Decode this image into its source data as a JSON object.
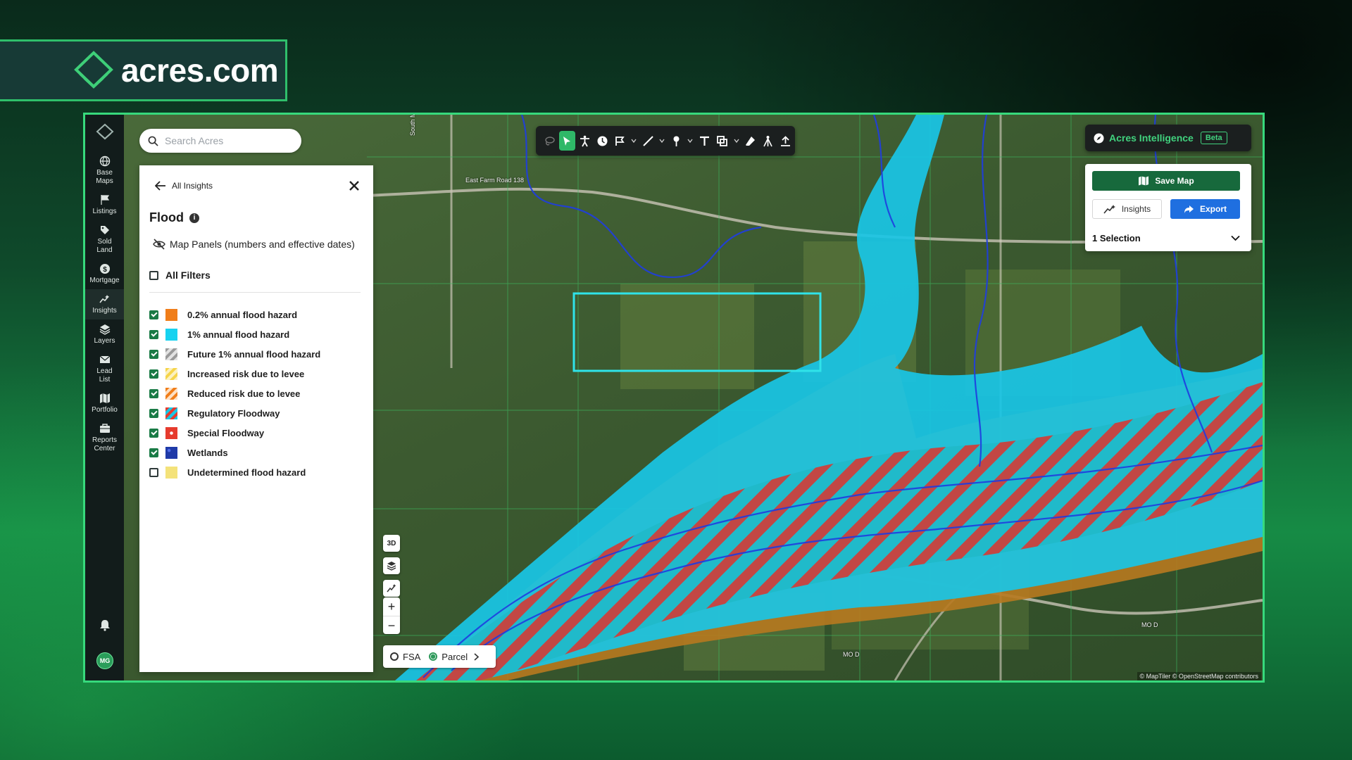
{
  "brand": {
    "name": "acres.com"
  },
  "search": {
    "placeholder": "Search Acres"
  },
  "sidebar": {
    "items": [
      {
        "label": "Base Maps",
        "icon": "globe-icon"
      },
      {
        "label": "Listings",
        "icon": "flag-icon"
      },
      {
        "label": "Sold Land",
        "icon": "tag-icon"
      },
      {
        "label": "Mortgage",
        "icon": "dollar-icon"
      },
      {
        "label": "Insights",
        "icon": "insights-icon",
        "active": true
      },
      {
        "label": "Layers",
        "icon": "layers-icon"
      },
      {
        "label": "Lead List",
        "icon": "mail-icon"
      },
      {
        "label": "Portfolio",
        "icon": "map-icon"
      },
      {
        "label": "Reports Center",
        "icon": "briefcase-icon"
      }
    ],
    "user_initials": "MG"
  },
  "panel": {
    "back_label": "All Insights",
    "title": "Flood",
    "map_panels_label": "Map Panels (numbers and effective dates)",
    "all_filters_label": "All Filters",
    "filters": [
      {
        "label": "0.2% annual flood hazard",
        "checked": true,
        "color": "#f07e1a"
      },
      {
        "label": "1% annual flood hazard",
        "checked": true,
        "color": "#17d2f0"
      },
      {
        "label": "Future 1% annual flood hazard",
        "checked": true,
        "color": "#b0b0b0"
      },
      {
        "label": "Increased risk due to levee",
        "checked": true,
        "color": "#f6d44a"
      },
      {
        "label": "Reduced risk due to levee",
        "checked": true,
        "color": "#f07e1a"
      },
      {
        "label": "Regulatory Floodway",
        "checked": true,
        "color": "#e63b2e"
      },
      {
        "label": "Special Floodway",
        "checked": true,
        "color": "#e63b2e"
      },
      {
        "label": "Wetlands",
        "checked": true,
        "color": "#1f3aa8"
      },
      {
        "label": "Undetermined flood hazard",
        "checked": false,
        "color": "#f4e27a"
      }
    ]
  },
  "toolbar": {
    "tools": [
      "lasso-icon",
      "select-icon",
      "accessibility-icon",
      "clock-icon",
      "flag-draw-icon",
      "line-icon",
      "pin-icon",
      "text-icon",
      "shapes-icon",
      "eraser-icon",
      "surveyor-icon",
      "upload-icon"
    ]
  },
  "intelligence": {
    "label": "Acres Intelligence",
    "badge": "Beta"
  },
  "actions": {
    "save_map": "Save Map",
    "insights": "Insights",
    "export": "Export",
    "selection": "1 Selection"
  },
  "map": {
    "controls": {
      "three_d": "3D"
    },
    "layer_switch": {
      "option_a": "FSA",
      "option_b": "Parcel",
      "selected": "Parcel"
    },
    "labels": {
      "road_1": "East Farm Road 138",
      "road_2": "South McCrite",
      "road_3": "MO D",
      "road_4": "MO D"
    },
    "attribution": "© MapTiler © OpenStreetMap contributors"
  },
  "colors": {
    "accent": "#2fb868",
    "brand_border": "#37d97c",
    "export": "#1f6fe0",
    "flood_cyan": "#17d2f0",
    "floodway_red": "#e63b2e"
  }
}
